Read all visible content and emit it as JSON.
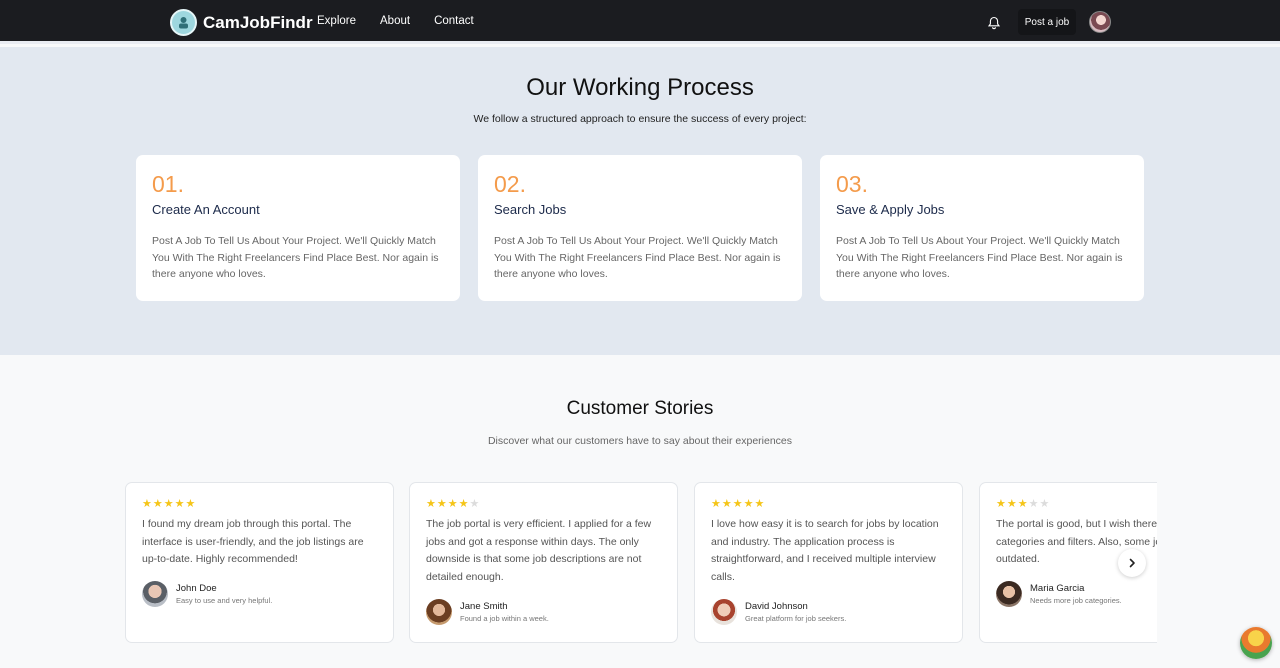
{
  "nav": {
    "brand": "CamJobFindr",
    "links": [
      "Explore",
      "About",
      "Contact"
    ],
    "post_job": "Post a job"
  },
  "process": {
    "title": "Our Working Process",
    "subtitle": "We follow a structured approach to ensure the success of every project:",
    "steps": [
      {
        "number": "01.",
        "title": "Create An Account",
        "text": "Post A Job To Tell Us About Your Project. We'll Quickly Match You With The Right Freelancers Find Place Best. Nor again is there anyone who loves."
      },
      {
        "number": "02.",
        "title": "Search Jobs",
        "text": "Post A Job To Tell Us About Your Project. We'll Quickly Match You With The Right Freelancers Find Place Best. Nor again is there anyone who loves."
      },
      {
        "number": "03.",
        "title": "Save & Apply Jobs",
        "text": "Post A Job To Tell Us About Your Project. We'll Quickly Match You With The Right Freelancers Find Place Best. Nor again is there anyone who loves."
      }
    ]
  },
  "stories": {
    "title": "Customer Stories",
    "subtitle": "Discover what our customers have to say about their experiences",
    "items": [
      {
        "rating": 5,
        "text": "I found my dream job through this portal. The interface is user-friendly, and the job listings are up-to-date. Highly recommended!",
        "name": "John Doe",
        "note": "Easy to use and very helpful."
      },
      {
        "rating": 4,
        "text": "The job portal is very efficient. I applied for a few jobs and got a response within days. The only downside is that some job descriptions are not detailed enough.",
        "name": "Jane Smith",
        "note": "Found a job within a week."
      },
      {
        "rating": 5,
        "text": "I love how easy it is to search for jobs by location and industry. The application process is straightforward, and I received multiple interview calls.",
        "name": "David Johnson",
        "note": "Great platform for job seekers."
      },
      {
        "rating": 3,
        "text": "The portal is good, but I wish there were more categories and filters. Also, some job listings are outdated.",
        "name": "Maria Garcia",
        "note": "Needs more job categories."
      }
    ]
  },
  "colors": {
    "accent": "#f49b4b",
    "navbar": "#1b1c20",
    "star": "#f5c518",
    "process_bg": "#e2e8f0"
  },
  "icons": [
    "logo-icon",
    "bell-icon",
    "chevron-right-icon",
    "star-icon"
  ]
}
